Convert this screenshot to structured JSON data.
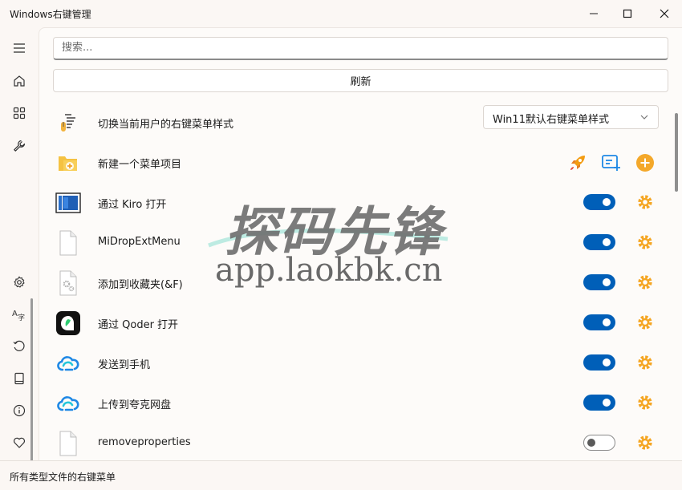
{
  "window": {
    "title": "Windows右键管理"
  },
  "search": {
    "placeholder": "搜索..."
  },
  "refresh_label": "刷新",
  "rows": [
    {
      "label": "切换当前用户的右键菜单样式",
      "icon": "menu-style-icon",
      "dropdown_value": "Win11默认右键菜单样式"
    },
    {
      "label": "新建一个菜单项目",
      "icon": "new-folder-icon"
    },
    {
      "label": "通过 Kiro 打开",
      "icon": "kiro-app-icon",
      "enabled": true
    },
    {
      "label": "MiDropExtMenu",
      "icon": "blank-file-icon",
      "enabled": true
    },
    {
      "label": "添加到收藏夹(&F)",
      "icon": "gear-file-icon",
      "enabled": true
    },
    {
      "label": "通过 Qoder 打开",
      "icon": "qoder-app-icon",
      "enabled": true
    },
    {
      "label": "发送到手机",
      "icon": "cloud-sync-icon",
      "enabled": true
    },
    {
      "label": "上传到夸克网盘",
      "icon": "cloud-sync-icon",
      "enabled": true
    },
    {
      "label": "removeproperties",
      "icon": "blank-file-icon",
      "enabled": false
    }
  ],
  "status": {
    "text": "所有类型文件的右键菜单"
  },
  "watermark": {
    "cn": "探码先锋",
    "url": "app.laokbk.cn"
  },
  "colors": {
    "accent": "#005fb8",
    "gear": "#f5a623",
    "add": "#f4a82a",
    "rocket": "#f39c12",
    "edit": "#1e88e5"
  }
}
